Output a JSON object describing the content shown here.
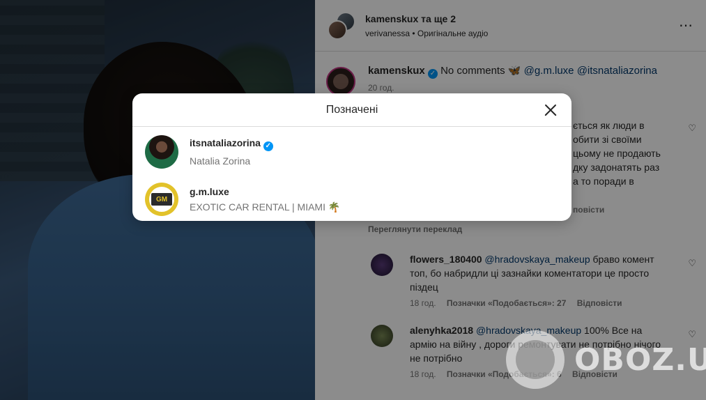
{
  "post": {
    "header": {
      "title_user": "kamenskux",
      "title_more": "та ще 2",
      "subtitle": "verivanessa • Оригінальне аудіо",
      "more_icon": "⋯"
    },
    "caption": {
      "user": "kamenskux",
      "text": "No comments 🦋",
      "mentions": "@g.m.luxe @itsnataliazorina",
      "time": "20 год."
    },
    "comment1_fragment": [
      "ється як люди в",
      "обити зі своїми",
      "цьому не продають",
      "дку задонатять раз",
      "а то поради в"
    ],
    "comment1_reply": "повісти",
    "translate": "Переглянути переклад",
    "replies": [
      {
        "user": "flowers_180400",
        "mention": "@hradovskaya_makeup",
        "text": "браво комент топ, бо набридли ці зазнайки коментатори це просто піздец",
        "time": "18 год.",
        "likes": "Позначки «Подобається»: 27",
        "reply": "Відповісти"
      },
      {
        "user": "alenyhka2018",
        "mention": "@hradovskaya_makeup",
        "text": "100% Все на армію на війну , дороги ремонтувати не потрібно нічого не потрібно",
        "time": "18 год.",
        "likes": "Позначки «Подобається»: 6",
        "reply": "Відповісти"
      }
    ]
  },
  "modal": {
    "title": "Позначені",
    "close_icon": "close-icon",
    "tags": [
      {
        "username": "itsnataliazorina",
        "name": "Natalia Zorina",
        "verified": true
      },
      {
        "username": "g.m.luxe",
        "name": "EXOTIC CAR RENTAL | MIAMI 🌴",
        "verified": false,
        "logo": "GM"
      }
    ]
  },
  "watermark": {
    "text": "OBOZ.UA"
  },
  "colors": {
    "accent": "#0095f6",
    "mention": "#00376b",
    "text": "#262626",
    "muted": "#737373"
  }
}
